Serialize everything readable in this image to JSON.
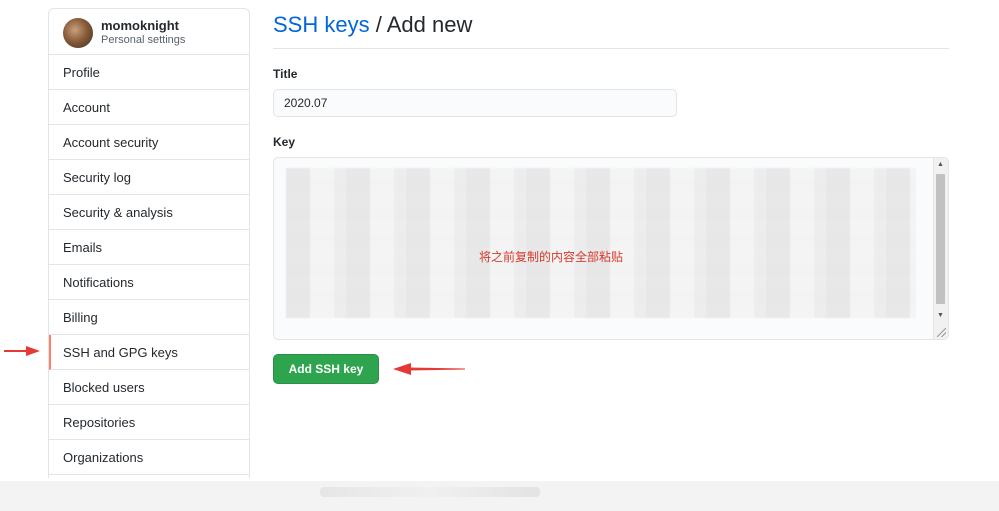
{
  "sidebar": {
    "username": "momoknight",
    "subtitle": "Personal settings",
    "items": [
      {
        "label": "Profile"
      },
      {
        "label": "Account"
      },
      {
        "label": "Account security"
      },
      {
        "label": "Security log"
      },
      {
        "label": "Security & analysis"
      },
      {
        "label": "Emails"
      },
      {
        "label": "Notifications"
      },
      {
        "label": "Billing"
      },
      {
        "label": "SSH and GPG keys",
        "selected": true
      },
      {
        "label": "Blocked users"
      },
      {
        "label": "Repositories"
      },
      {
        "label": "Organizations"
      }
    ]
  },
  "main": {
    "breadcrumb_link": "SSH keys",
    "breadcrumb_rest": " / Add new",
    "title_label": "Title",
    "title_value": "2020.07",
    "key_label": "Key",
    "key_hint": "将之前复制的内容全部粘贴",
    "submit_label": "Add SSH key"
  },
  "colors": {
    "link": "#0366d6",
    "button_green": "#2ea44f",
    "annotation_red": "#e53935",
    "selected_accent": "#f9826c"
  },
  "icons": {
    "avatar": "avatar-image",
    "left_arrow": "red-arrow-right-icon",
    "button_arrow": "red-arrow-left-icon"
  }
}
